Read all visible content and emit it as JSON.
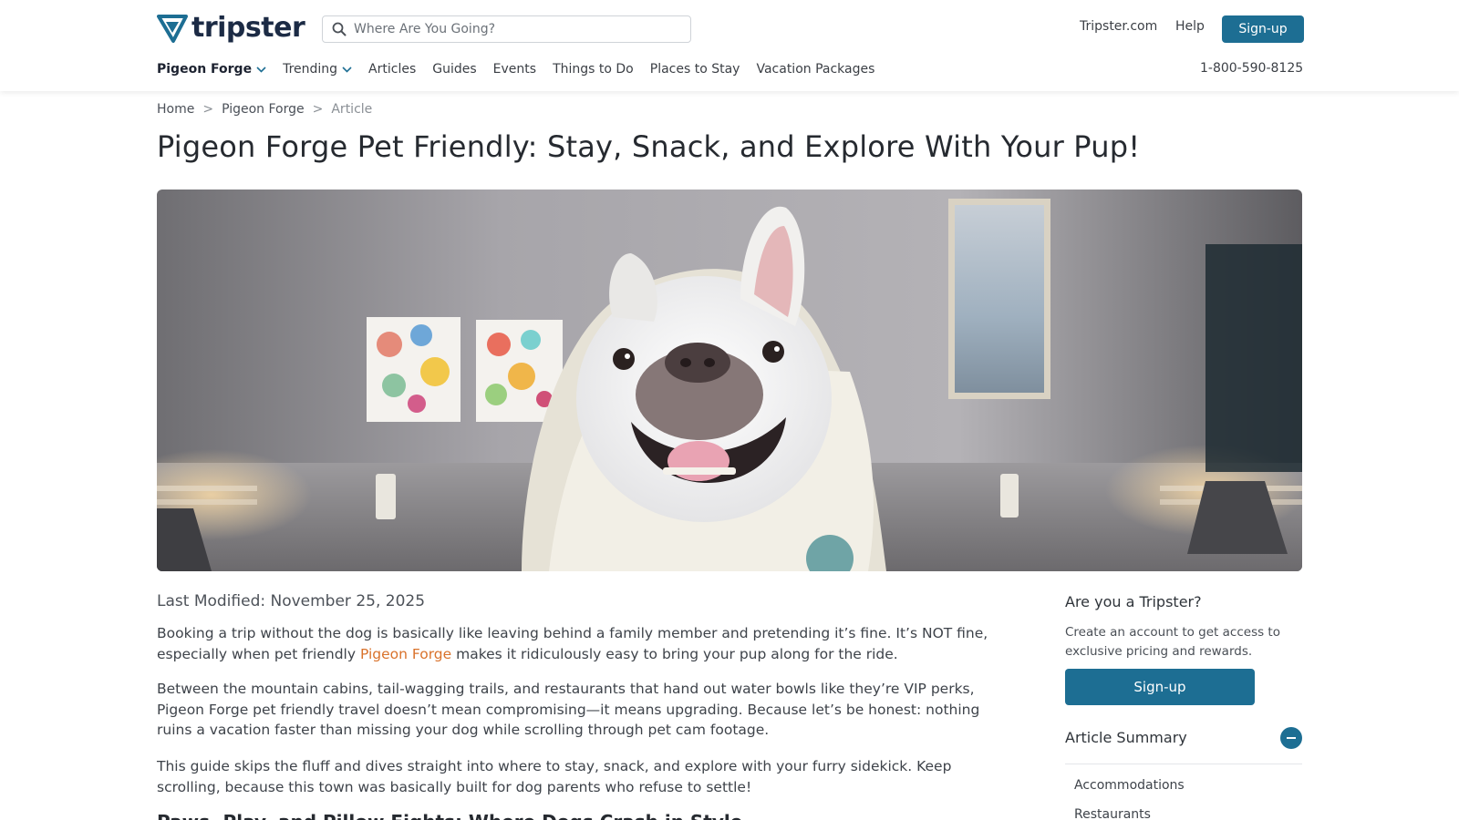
{
  "header": {
    "logo_text": "tripster",
    "search_placeholder": "Where Are You Going?",
    "links": [
      "Tripster.com",
      "Help"
    ],
    "signup_label": "Sign-up",
    "phone": "1-800-590-8125"
  },
  "nav": {
    "items": [
      "Pigeon Forge",
      "Trending",
      "Articles",
      "Guides",
      "Events",
      "Things to Do",
      "Places to Stay",
      "Vacation Packages"
    ]
  },
  "breadcrumb": {
    "items": [
      "Home",
      "Pigeon Forge",
      "Article"
    ],
    "separator": ">"
  },
  "article": {
    "title": "Pigeon Forge Pet Friendly: Stay, Snack, and Explore With Your Pup!",
    "last_modified": "Last Modified: November 25, 2025",
    "p1_before": "Booking a trip without the dog is basically like leaving behind a family member and pretending it’s fine. It’s NOT fine, especially when pet friendly ",
    "p1_link": "Pigeon Forge",
    "p1_after": " makes it ridiculously easy to bring your pup along for the ride.",
    "p2": "Between the mountain cabins, tail-wagging trails, and restaurants that hand out water bowls like they’re VIP perks, Pigeon Forge pet friendly travel doesn’t mean compromising—it means upgrading. Because let’s be honest: nothing ruins a vacation faster than missing your dog while scrolling through pet cam footage.",
    "p3": "This guide skips the fluff and dives straight into where to stay, snack, and explore with your furry sidekick. Keep scrolling, because this town was basically built for dog parents who refuse to settle!",
    "h2": "Paws, Play, and Pillow Fights: Where Dogs Crash in Style"
  },
  "sidebar": {
    "title": "Are you a Tripster?",
    "description": "Create an account to get access to exclusive pricing and rewards.",
    "signup_label": "Sign-up",
    "summary_title": "Article Summary",
    "summary_items": [
      "Accommodations",
      "Restaurants"
    ]
  },
  "colors": {
    "brand": "#1d6e93",
    "link": "#d9722b",
    "logo": "#1c2b45"
  }
}
